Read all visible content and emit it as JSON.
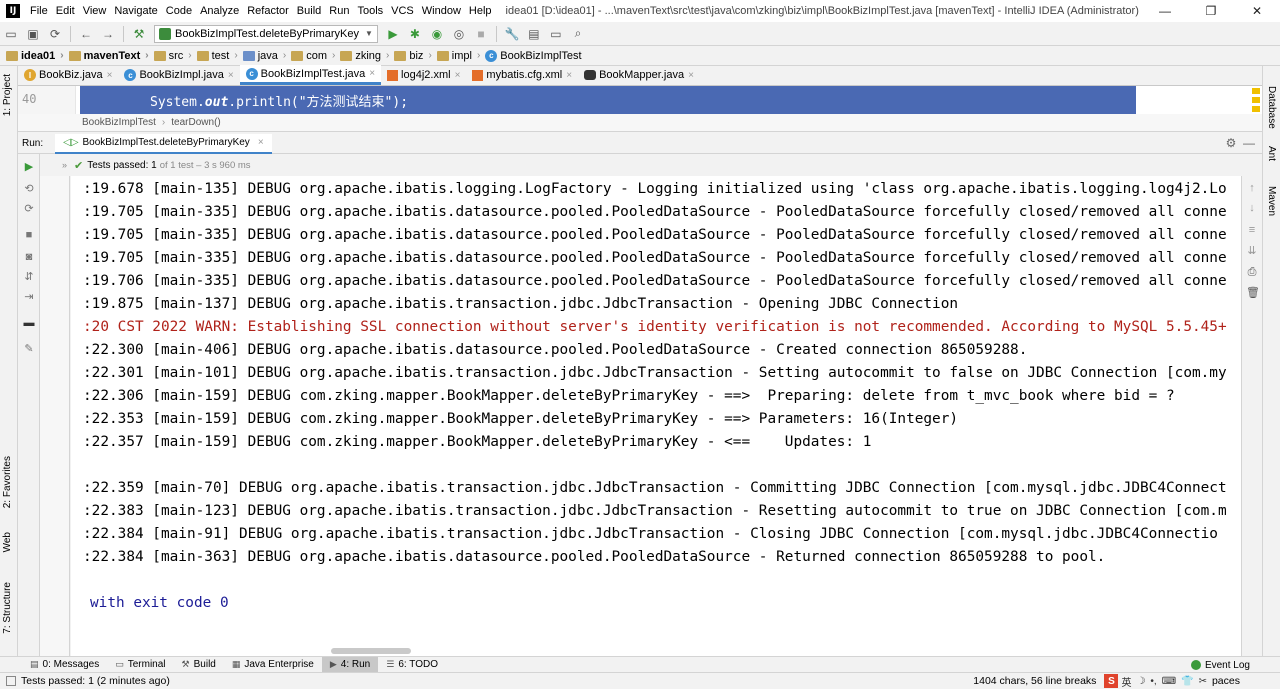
{
  "window": {
    "title": "idea01 [D:\\idea01] - ...\\mavenText\\src\\test\\java\\com\\zking\\biz\\impl\\BookBizImplTest.java [mavenText] - IntelliJ IDEA (Administrator)",
    "logo": "IJ",
    "minimize": "—",
    "maximize": "❐",
    "close": "✕"
  },
  "menu": [
    "File",
    "Edit",
    "View",
    "Navigate",
    "Code",
    "Analyze",
    "Refactor",
    "Build",
    "Run",
    "Tools",
    "VCS",
    "Window",
    "Help"
  ],
  "toolbar": {
    "run_config": "BookBizImplTest.deleteByPrimaryKey"
  },
  "navbar": {
    "crumbs": [
      "idea01",
      "mavenText",
      "src",
      "test",
      "java",
      "com",
      "zking",
      "biz",
      "impl",
      "BookBizImplTest"
    ]
  },
  "tabs": [
    {
      "label": "BookBiz.java",
      "icon": "interface-icon"
    },
    {
      "label": "BookBizImpl.java",
      "icon": "class-icon"
    },
    {
      "label": "BookBizImplTest.java",
      "icon": "class-icon"
    },
    {
      "label": "log4j2.xml",
      "icon": "xml-icon"
    },
    {
      "label": "mybatis.cfg.xml",
      "icon": "xml-icon"
    },
    {
      "label": "BookMapper.java",
      "icon": "mapper-icon"
    }
  ],
  "tab_close": "×",
  "editor": {
    "line_number": "40",
    "code_prefix": "System.",
    "code_kw": "out",
    "code_suffix": ".println(\"方法测试结束\");"
  },
  "code_breadcrumb": {
    "class": "BookBizImplTest",
    "method": "tearDown()"
  },
  "run_panel": {
    "label": "Run:",
    "tab": "BookBizImplTest.deleteByPrimaryKey",
    "tests_passed": "Tests passed:",
    "passed_count": "1",
    "detail": "of 1 test – 3 s 960 ms"
  },
  "console": {
    "lines": [
      {
        "text": ":19.678 [main-135] DEBUG org.apache.ibatis.logging.LogFactory - Logging initialized using 'class org.apache.ibatis.logging.log4j2.Lo",
        "type": "normal"
      },
      {
        "text": ":19.705 [main-335] DEBUG org.apache.ibatis.datasource.pooled.PooledDataSource - PooledDataSource forcefully closed/removed all conne",
        "type": "normal"
      },
      {
        "text": ":19.705 [main-335] DEBUG org.apache.ibatis.datasource.pooled.PooledDataSource - PooledDataSource forcefully closed/removed all conne",
        "type": "normal"
      },
      {
        "text": ":19.705 [main-335] DEBUG org.apache.ibatis.datasource.pooled.PooledDataSource - PooledDataSource forcefully closed/removed all conne",
        "type": "normal"
      },
      {
        "text": ":19.706 [main-335] DEBUG org.apache.ibatis.datasource.pooled.PooledDataSource - PooledDataSource forcefully closed/removed all conne",
        "type": "normal"
      },
      {
        "text": ":19.875 [main-137] DEBUG org.apache.ibatis.transaction.jdbc.JdbcTransaction - Opening JDBC Connection",
        "type": "normal"
      },
      {
        "text": ":20 CST 2022 WARN: Establishing SSL connection without server's identity verification is not recommended. According to MySQL 5.5.45+",
        "type": "warn"
      },
      {
        "text": ":22.300 [main-406] DEBUG org.apache.ibatis.datasource.pooled.PooledDataSource - Created connection 865059288.",
        "type": "normal"
      },
      {
        "text": ":22.301 [main-101] DEBUG org.apache.ibatis.transaction.jdbc.JdbcTransaction - Setting autocommit to false on JDBC Connection [com.my",
        "type": "normal"
      },
      {
        "text": ":22.306 [main-159] DEBUG com.zking.mapper.BookMapper.deleteByPrimaryKey - ==>  Preparing: delete from t_mvc_book where bid = ?",
        "type": "normal"
      },
      {
        "text": ":22.353 [main-159] DEBUG com.zking.mapper.BookMapper.deleteByPrimaryKey - ==> Parameters: 16(Integer)",
        "type": "normal"
      },
      {
        "text": ":22.357 [main-159] DEBUG com.zking.mapper.BookMapper.deleteByPrimaryKey - <==    Updates: 1",
        "type": "normal"
      },
      {
        "text": "",
        "type": "normal"
      },
      {
        "text": ":22.359 [main-70] DEBUG org.apache.ibatis.transaction.jdbc.JdbcTransaction - Committing JDBC Connection [com.mysql.jdbc.JDBC4Connect",
        "type": "normal"
      },
      {
        "text": ":22.383 [main-123] DEBUG org.apache.ibatis.transaction.jdbc.JdbcTransaction - Resetting autocommit to true on JDBC Connection [com.m",
        "type": "normal"
      },
      {
        "text": ":22.384 [main-91] DEBUG org.apache.ibatis.transaction.jdbc.JdbcTransaction - Closing JDBC Connection [com.mysql.jdbc.JDBC4Connectio",
        "type": "normal"
      },
      {
        "text": ":22.384 [main-363] DEBUG org.apache.ibatis.datasource.pooled.PooledDataSource - Returned connection 865059288 to pool.",
        "type": "normal"
      },
      {
        "text": "",
        "type": "normal"
      },
      {
        "text": "with exit code 0",
        "type": "exit"
      }
    ]
  },
  "side_tabs": {
    "left": [
      "1: Project",
      "2: Favorites",
      "Web",
      "7: Structure"
    ],
    "right": [
      "Database",
      "Ant",
      "Maven"
    ]
  },
  "tool_windows": [
    {
      "label": "0: Messages",
      "active": false
    },
    {
      "label": "Terminal",
      "active": false
    },
    {
      "label": "Build",
      "active": false
    },
    {
      "label": "Java Enterprise",
      "active": false
    },
    {
      "label": "4: Run",
      "active": true
    },
    {
      "label": "6: TODO",
      "active": false
    }
  ],
  "event_log": "Event Log",
  "statusbar": {
    "left": "Tests passed: 1 (2 minutes ago)",
    "chars": "1404 chars, 56 line breaks",
    "ime_lang": "英",
    "spaces": "paces"
  },
  "colors": {
    "selection": "#4a69b3",
    "warn": "#b0221a",
    "exit": "#1c1c96",
    "passed": "#4a9a3a"
  }
}
